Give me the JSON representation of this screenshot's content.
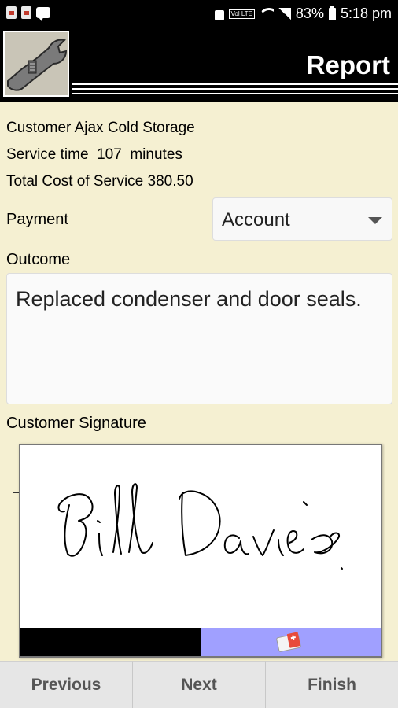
{
  "status_bar": {
    "battery": "83%",
    "time": "5:18 pm",
    "volte": "Vol LTE"
  },
  "header": {
    "title": "Report"
  },
  "info": {
    "customer_label": "Customer",
    "customer": "Ajax Cold Storage",
    "service_time_label": "Service time",
    "service_time": "107",
    "service_time_unit": "minutes",
    "total_cost_label": "Total Cost of Service",
    "total_cost": "380.50"
  },
  "payment": {
    "label": "Payment",
    "selected": "Account"
  },
  "outcome": {
    "label": "Outcome",
    "value": "Replaced condenser and door seals."
  },
  "signature": {
    "label": "Customer Signature",
    "signed_name": "Bill Davies"
  },
  "nav": {
    "previous": "Previous",
    "next": "Next",
    "finish": "Finish"
  }
}
